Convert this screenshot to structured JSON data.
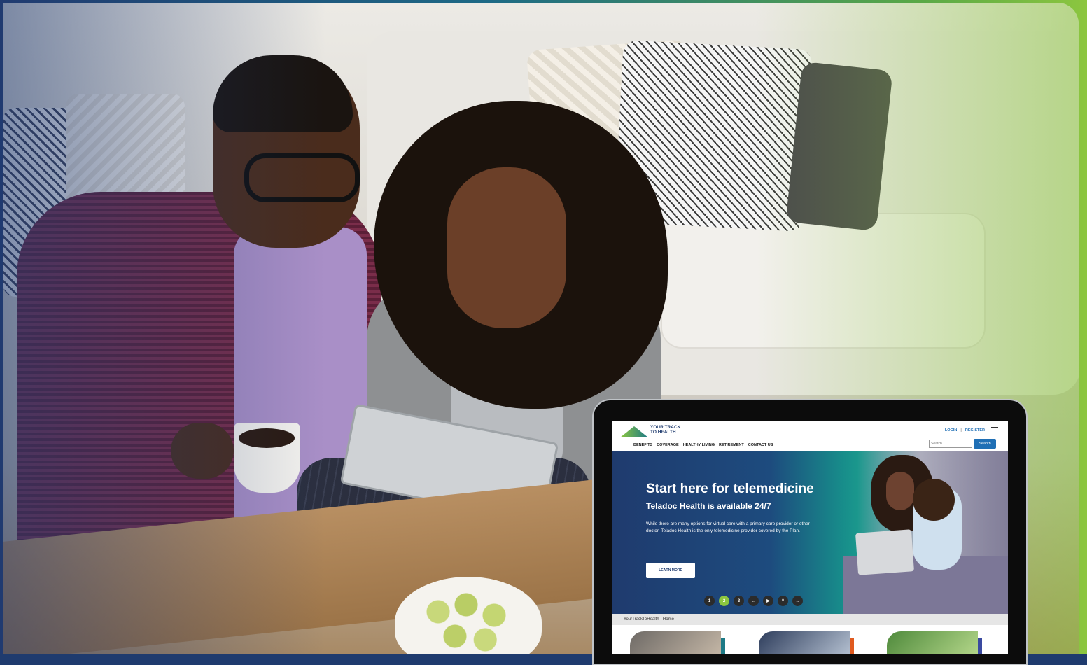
{
  "site": {
    "logo_text": "YOUR TRACK\nTO HEALTH",
    "utility_links": [
      "LOGIN",
      "REGISTER"
    ],
    "nav_items": [
      "BENEFITS",
      "COVERAGE",
      "HEALTHY LIVING",
      "RETIREMENT",
      "CONTACT US"
    ],
    "search": {
      "placeholder": "Search",
      "button_label": "Search"
    }
  },
  "hero": {
    "title": "Start here for telemedicine",
    "subtitle": "Teladoc Health is available 24/7",
    "body": "While there are many options for virtual care with a primary care provider or other doctor, Teladoc Health is the only telemedicine provider covered by the Plan.",
    "cta_label": "LEARN MORE",
    "carousel": {
      "pages": [
        "1",
        "2",
        "3"
      ],
      "active_page": "2",
      "controls": [
        "←",
        "▶",
        "⏸",
        "→"
      ]
    }
  },
  "breadcrumb": "YourTrackToHealth - Home",
  "colors": {
    "brand_blue": "#1f3b6e",
    "brand_green": "#8cc63f",
    "link_blue": "#1f6fb5"
  },
  "cards": [
    {
      "accent": "#1d7a86"
    },
    {
      "accent": "#e05a1f"
    },
    {
      "accent": "#3a4aa0"
    }
  ]
}
